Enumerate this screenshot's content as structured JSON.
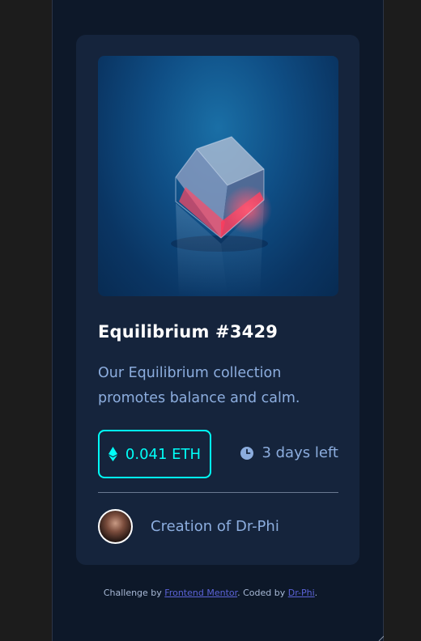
{
  "card": {
    "title": "Equilibrium #3429",
    "description": "Our Equilibrium collection promotes balance and calm.",
    "price": "0.041 ETH",
    "time_left": "3 days left",
    "creator_prefix": "Creation of ",
    "creator_name": "Dr-Phi"
  },
  "footer": {
    "text_1": "Challenge by ",
    "link_1": "Frontend Mentor",
    "text_2": ". Coded by ",
    "link_2": "Dr-Phi",
    "text_3": "."
  },
  "icons": {
    "price": "ethereum-icon",
    "time": "clock-icon"
  },
  "colors": {
    "background": "#0d1829",
    "card": "#15243c",
    "accent": "#00fff8",
    "text_soft": "#8cadde",
    "link": "#5b63d8"
  }
}
